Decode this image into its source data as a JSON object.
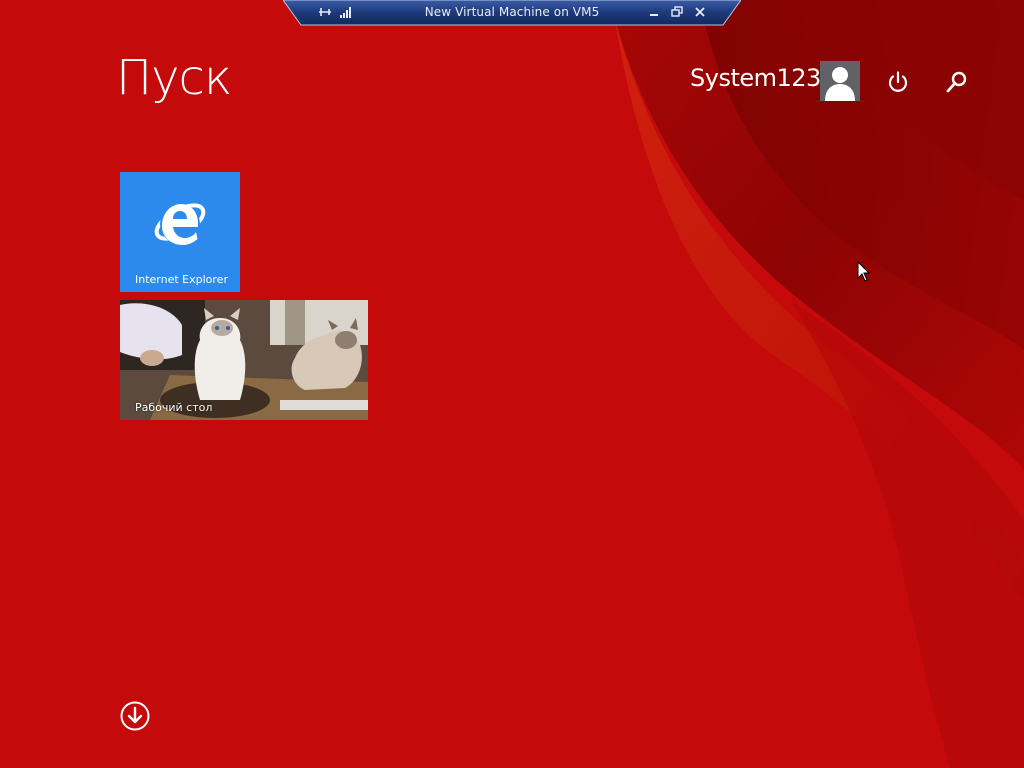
{
  "vm_bar": {
    "title": "New Virtual Machine on VM5",
    "icons": [
      "pin-icon",
      "signal-icon",
      "minimize-icon",
      "restore-icon",
      "close-icon"
    ]
  },
  "start": {
    "title": "Пуск"
  },
  "user": {
    "name": "System123",
    "icons": [
      "user-avatar-icon",
      "power-icon",
      "search-icon"
    ]
  },
  "tiles": [
    {
      "label": "Internet Explorer",
      "icon": "internet-explorer-icon",
      "color": "#2b8aec"
    },
    {
      "label": "Рабочий стол",
      "icon": "desktop-wallpaper-cats"
    }
  ],
  "footer": {
    "icon": "all-apps-arrow-down-icon"
  },
  "colors": {
    "background": "#c40a0a",
    "vm_bar": "#1d3a7a",
    "tile_blue": "#2b8aec"
  }
}
